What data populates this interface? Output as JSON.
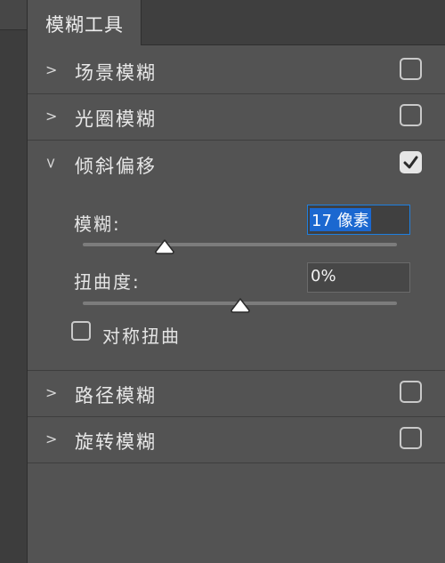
{
  "panel": {
    "tab_title": "模糊工具"
  },
  "sections": {
    "field_blur": {
      "label": "场景模糊",
      "checked": false
    },
    "iris_blur": {
      "label": "光圈模糊",
      "checked": false
    },
    "tilt_shift": {
      "label": "倾斜偏移",
      "checked": true,
      "blur": {
        "label": "模糊:",
        "value": "17 像素",
        "slider_fraction": 0.26
      },
      "distortion": {
        "label": "扭曲度:",
        "value": "0%",
        "slider_fraction": 0.5
      },
      "symmetric": {
        "label": "对称扭曲",
        "checked": false
      }
    },
    "path_blur": {
      "label": "路径模糊",
      "checked": false
    },
    "spin_blur": {
      "label": "旋转模糊",
      "checked": false
    }
  },
  "icons": {
    "collapsed": "chevron-right-icon",
    "expanded": "chevron-down-icon",
    "check": "checkmark-icon",
    "thumb": "slider-thumb-icon"
  },
  "colors": {
    "panel_bg": "#535353",
    "highlight": "#1b68d0"
  }
}
